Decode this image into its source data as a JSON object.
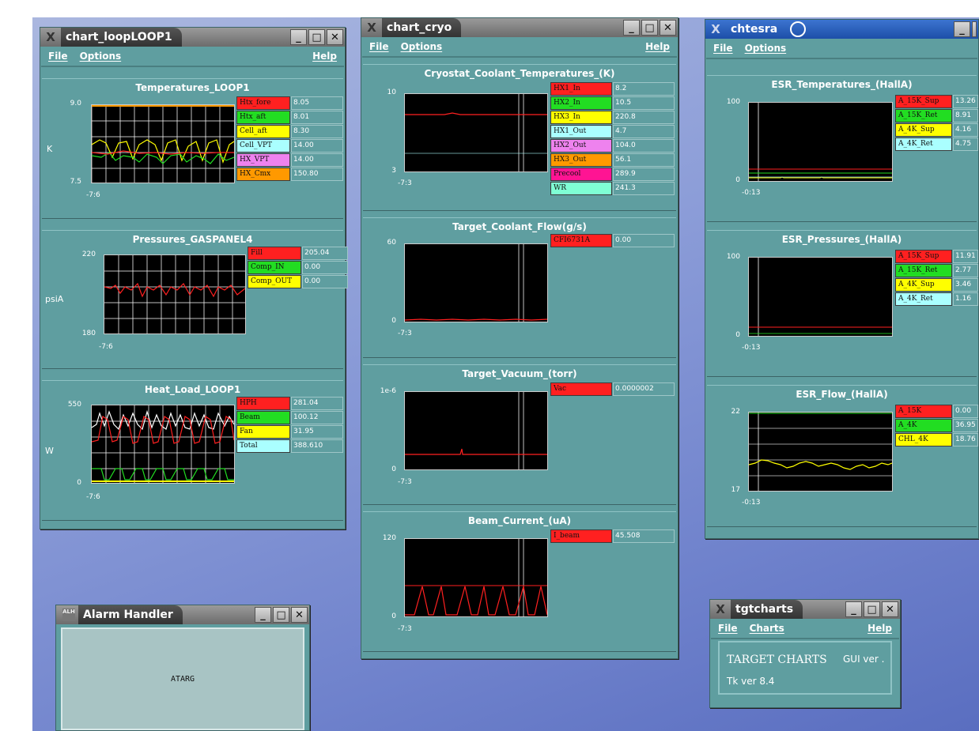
{
  "colors": {
    "red": "#ff2020",
    "green": "#22dd22",
    "yellow": "#ffff00",
    "cyan": "#aaffff",
    "violet": "#ee82ee",
    "orange": "#ff9900",
    "deeppink": "#ff1493",
    "aquamarine": "#7fffd4",
    "white": "#ffffff"
  },
  "menu": {
    "file": "File",
    "options": "Options",
    "help": "Help",
    "charts": "Charts"
  },
  "windows": {
    "loop": {
      "title": "chart_loopLOOP1",
      "panels": [
        {
          "title": "Temperatures_LOOP1",
          "unit": "K",
          "ymax": "9.0",
          "ymin": "7.5",
          "xlabel": "-7:6",
          "legend": [
            {
              "name": "Htx_fore",
              "value": "8.05",
              "color": "red"
            },
            {
              "name": "Htx_aft",
              "value": "8.01",
              "color": "green"
            },
            {
              "name": "Cell_aft",
              "value": "8.30",
              "color": "yellow"
            },
            {
              "name": "Cell_VPT",
              "value": "14.00",
              "color": "cyan"
            },
            {
              "name": "HX_VPT",
              "value": "14.00",
              "color": "violet"
            },
            {
              "name": "HX_Cmx",
              "value": "150.80",
              "color": "orange"
            }
          ]
        },
        {
          "title": "Pressures_GASPANEL4",
          "unit": "psiA",
          "ymax": "220",
          "ymin": "180",
          "xlabel": "-7:6",
          "legend": [
            {
              "name": "Fill",
              "value": "205.04",
              "color": "red"
            },
            {
              "name": "Comp_IN",
              "value": "0.00",
              "color": "green"
            },
            {
              "name": "Comp_OUT",
              "value": "0.00",
              "color": "yellow"
            }
          ]
        },
        {
          "title": "Heat_Load_LOOP1",
          "unit": "W",
          "ymax": "550",
          "ymin": "0",
          "xlabel": "-7:6",
          "legend": [
            {
              "name": "HPH",
              "value": "281.04",
              "color": "red"
            },
            {
              "name": "Beam",
              "value": "100.12",
              "color": "green"
            },
            {
              "name": "Fan",
              "value": "31.95",
              "color": "yellow"
            },
            {
              "name": "Total",
              "value": "388.610",
              "color": "cyan"
            }
          ]
        }
      ]
    },
    "cryo": {
      "title": "chart_cryo",
      "panels": [
        {
          "title": "Cryostat_Coolant_Temperatures_(K)",
          "unit": "",
          "ymax": "10",
          "ymin": "3",
          "xlabel": "-7:3",
          "legend": [
            {
              "name": "HX1_In",
              "value": "8.2",
              "color": "red"
            },
            {
              "name": "HX2_In",
              "value": "10.5",
              "color": "green"
            },
            {
              "name": "HX3_In",
              "value": "220.8",
              "color": "yellow"
            },
            {
              "name": "HX1_Out",
              "value": "4.7",
              "color": "cyan"
            },
            {
              "name": "HX2_Out",
              "value": "104.0",
              "color": "violet"
            },
            {
              "name": "HX3_Out",
              "value": "56.1",
              "color": "orange"
            },
            {
              "name": "Precool",
              "value": "289.9",
              "color": "deeppink"
            },
            {
              "name": "WR",
              "value": "241.3",
              "color": "aquamarine"
            }
          ]
        },
        {
          "title": "Target_Coolant_Flow(g/s)",
          "unit": "",
          "ymax": "60",
          "ymin": "0",
          "xlabel": "-7:3",
          "legend": [
            {
              "name": "CFI6731A",
              "value": "0.00",
              "color": "red"
            }
          ]
        },
        {
          "title": "Target_Vacuum_(torr)",
          "unit": "",
          "ymax": "1e-6",
          "ymin": "0",
          "xlabel": "-7:3",
          "legend": [
            {
              "name": "Vac",
              "value": "0.0000002",
              "color": "red"
            }
          ]
        },
        {
          "title": "Beam_Current_(uA)",
          "unit": "",
          "ymax": "120",
          "ymin": "0",
          "xlabel": "-7:3",
          "legend": [
            {
              "name": "I_beam",
              "value": "45.508",
              "color": "red"
            }
          ]
        }
      ]
    },
    "esr": {
      "title": "chtesra",
      "panels": [
        {
          "title": "ESR_Temperatures_(HallA)",
          "unit": "",
          "ymax": "100",
          "ymin": "0",
          "xlabel": "-0:13",
          "legend": [
            {
              "name": "A_15K_Sup",
              "value": "13.26",
              "color": "red"
            },
            {
              "name": "A_15K_Ret",
              "value": "8.91",
              "color": "green"
            },
            {
              "name": "A_4K_Sup",
              "value": "4.16",
              "color": "yellow"
            },
            {
              "name": "A_4K_Ret",
              "value": "4.75",
              "color": "cyan"
            }
          ]
        },
        {
          "title": "ESR_Pressures_(HallA)",
          "unit": "",
          "ymax": "100",
          "ymin": "0",
          "xlabel": "-0:13",
          "legend": [
            {
              "name": "A_15K_Sup",
              "value": "11.91",
              "color": "red"
            },
            {
              "name": "A_15K_Ret",
              "value": "2.77",
              "color": "green"
            },
            {
              "name": "A_4K_Sup",
              "value": "3.46",
              "color": "yellow"
            },
            {
              "name": "A_4K_Ret",
              "value": "1.16",
              "color": "cyan"
            }
          ]
        },
        {
          "title": "ESR_Flow_(HallA)",
          "unit": "",
          "ymax": "22",
          "ymin": "17",
          "xlabel": "-0:13",
          "legend": [
            {
              "name": "A_15K",
              "value": "0.00",
              "color": "red"
            },
            {
              "name": "A_4K",
              "value": "36.95",
              "color": "green"
            },
            {
              "name": "CHL_4K",
              "value": "18.76",
              "color": "yellow"
            }
          ]
        }
      ]
    },
    "alarm": {
      "title": "Alarm Handler",
      "icon_text": "ALH",
      "group": "ATARG"
    },
    "tgt": {
      "title": "tgtcharts",
      "heading": "TARGET CHARTS",
      "gui_ver": "GUI ver .",
      "tk_ver": "Tk ver 8.4"
    }
  }
}
